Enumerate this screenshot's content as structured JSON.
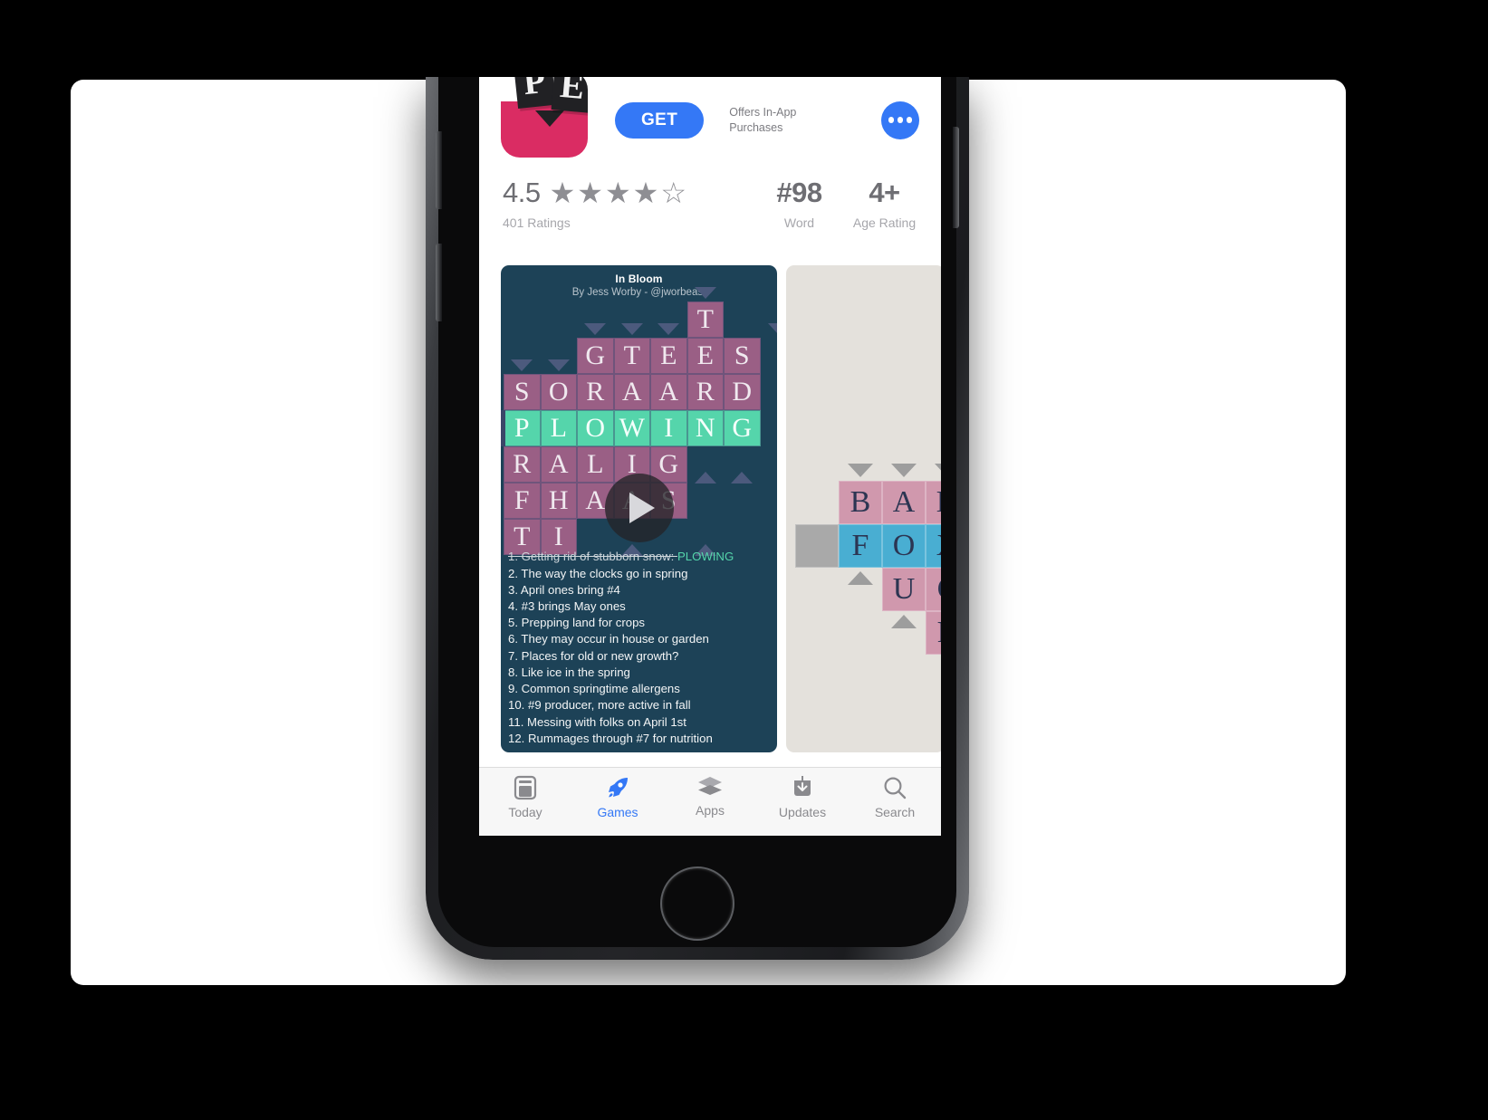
{
  "app": {
    "icon_tiles": [
      "P",
      "E"
    ],
    "icon_name": "app-icon-letterpress",
    "get_label": "GET",
    "iap_note": "Offers In-App\nPurchases",
    "more_label": "more-options"
  },
  "stats": {
    "rating": {
      "value": "4.5",
      "label": "401 Ratings",
      "stars_full": 4,
      "stars_half": 1,
      "stars_total": 5
    },
    "chart": {
      "value": "#98",
      "label": "Word"
    },
    "age": {
      "value": "4+",
      "label": "Age Rating"
    }
  },
  "screenshot1": {
    "title": "In Bloom",
    "subtitle": "By Jess Worby - @jworbeast",
    "grid_rows": [
      {
        "row": 0,
        "start": 5,
        "letters": [
          "T"
        ],
        "fill": "pink"
      },
      {
        "row": 1,
        "start": 2,
        "letters": [
          "G",
          "T",
          "E",
          "E",
          "S"
        ],
        "fill": "pink"
      },
      {
        "row": 2,
        "start": 0,
        "letters": [
          "S",
          "O",
          "R",
          "A",
          "A",
          "R",
          "D"
        ],
        "fill": "pink"
      },
      {
        "row": 3,
        "start": 0,
        "letters": [
          "P",
          "L",
          "O",
          "W",
          "I",
          "N",
          "G"
        ],
        "fill": "green"
      },
      {
        "row": 4,
        "start": 0,
        "letters": [
          "R",
          "A",
          "L",
          "I",
          "G"
        ],
        "fill": "pink"
      },
      {
        "row": 5,
        "start": 0,
        "letters": [
          "F",
          "H",
          "A",
          "A",
          "S"
        ],
        "fill": "pink"
      },
      {
        "row": 6,
        "start": 0,
        "letters": [
          "T",
          "I"
        ],
        "fill": "pink"
      }
    ],
    "clues": [
      {
        "n": "1.",
        "text": "Getting rid of stubborn snow:",
        "answer": "PLOWING",
        "solved": true
      },
      {
        "n": "2.",
        "text": "The way the clocks go in spring",
        "answer": "",
        "solved": false
      },
      {
        "n": "3.",
        "text": "April ones bring #4",
        "answer": "",
        "solved": false
      },
      {
        "n": "4.",
        "text": "#3 brings May ones",
        "answer": "",
        "solved": false
      },
      {
        "n": "5.",
        "text": "Prepping land for crops",
        "answer": "",
        "solved": false
      },
      {
        "n": "6.",
        "text": "They may occur in house or garden",
        "answer": "",
        "solved": false
      },
      {
        "n": "7.",
        "text": "Places for old or new growth?",
        "answer": "",
        "solved": false
      },
      {
        "n": "8.",
        "text": "Like ice in the spring",
        "answer": "",
        "solved": false
      },
      {
        "n": "9.",
        "text": "Common springtime allergens",
        "answer": "",
        "solved": false
      },
      {
        "n": "10.",
        "text": "#9 producer, more active in fall",
        "answer": "",
        "solved": false
      },
      {
        "n": "11.",
        "text": "Messing with folks on April 1st",
        "answer": "",
        "solved": false
      },
      {
        "n": "12.",
        "text": "Rummages through #7 for nutrition",
        "answer": "",
        "solved": false
      }
    ],
    "play_overlay": "play-button"
  },
  "screenshot2": {
    "grid_rows": [
      {
        "row": 0,
        "start": 1,
        "letters": [
          "B",
          "A",
          "N"
        ],
        "fill": "rose"
      },
      {
        "row": 1,
        "start": 0,
        "letters": [
          "",
          "F",
          "O",
          "X"
        ],
        "fill": "blue"
      },
      {
        "row": 2,
        "start": 2,
        "letters": [
          "U",
          "C"
        ],
        "fill": "rose"
      },
      {
        "row": 3,
        "start": 3,
        "letters": [
          "R"
        ],
        "fill": "rose"
      }
    ]
  },
  "tabbar": {
    "active": "Games",
    "items": [
      {
        "label": "Today",
        "icon": "today-icon"
      },
      {
        "label": "Games",
        "icon": "rocket-icon"
      },
      {
        "label": "Apps",
        "icon": "layers-icon"
      },
      {
        "label": "Updates",
        "icon": "download-icon"
      },
      {
        "label": "Search",
        "icon": "search-icon"
      }
    ]
  },
  "colors": {
    "accent_blue": "#3478f6",
    "shot1_bg": "#1d4257",
    "shot1_tile": "#9a5f85",
    "shot1_solved": "#55d5ab",
    "shot2_bg": "#e4e1dc",
    "shot2_rose": "#d098ad",
    "shot2_blue": "#49aed2",
    "icon_pink": "#da2c63"
  }
}
